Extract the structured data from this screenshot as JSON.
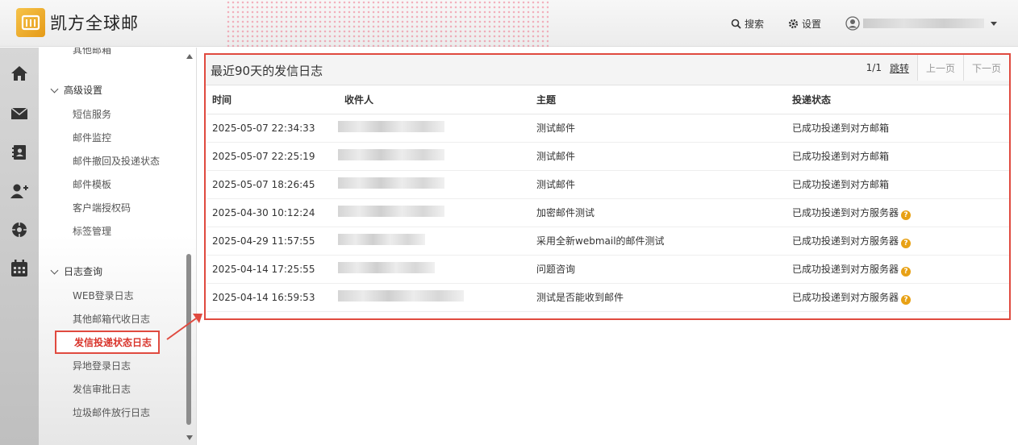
{
  "brand": {
    "name": "凯方全球邮"
  },
  "header": {
    "search_label": "搜索",
    "settings_label": "设置"
  },
  "rail": {
    "icons": [
      "home-icon",
      "mail-icon",
      "contacts-icon",
      "add-user-icon",
      "target-icon",
      "calendar-icon"
    ]
  },
  "sidebar": {
    "partial_item": "其他邮箱",
    "groups": [
      {
        "label": "高级设置",
        "items": [
          "短信服务",
          "邮件监控",
          "邮件撤回及投递状态",
          "邮件模板",
          "客户端授权码",
          "标签管理"
        ]
      },
      {
        "label": "日志查询",
        "items": [
          "WEB登录日志",
          "其他邮箱代收日志",
          "发信投递状态日志",
          "异地登录日志",
          "发信审批日志",
          "垃圾邮件放行日志"
        ]
      }
    ],
    "active_item": "发信投递状态日志"
  },
  "panel": {
    "title": "最近90天的发信日志",
    "page": "1/1",
    "jump": "跳转",
    "prev": "上一页",
    "next": "下一页",
    "columns": [
      "时间",
      "收件人",
      "主题",
      "投递状态"
    ],
    "rows": [
      {
        "time": "2025-05-07 22:34:33",
        "subject": "测试邮件",
        "status": "已成功投递到对方邮箱",
        "help": false
      },
      {
        "time": "2025-05-07 22:25:19",
        "subject": "测试邮件",
        "status": "已成功投递到对方邮箱",
        "help": false
      },
      {
        "time": "2025-05-07 18:26:45",
        "subject": "测试邮件",
        "status": "已成功投递到对方邮箱",
        "help": false
      },
      {
        "time": "2025-04-30 10:12:24",
        "subject": "加密邮件测试",
        "status": "已成功投递到对方服务器",
        "help": true
      },
      {
        "time": "2025-04-29 11:57:55",
        "subject": "采用全新webmail的邮件测试",
        "status": "已成功投递到对方服务器",
        "help": true
      },
      {
        "time": "2025-04-14 17:25:55",
        "subject": "问题咨询",
        "status": "已成功投递到对方服务器",
        "help": true
      },
      {
        "time": "2025-04-14 16:59:53",
        "subject": "测试是否能收到邮件",
        "status": "已成功投递到对方服务器",
        "help": true
      }
    ]
  },
  "colors": {
    "accent": "#e04a3f",
    "active_text": "#d9342b",
    "help": "#e8a115"
  }
}
